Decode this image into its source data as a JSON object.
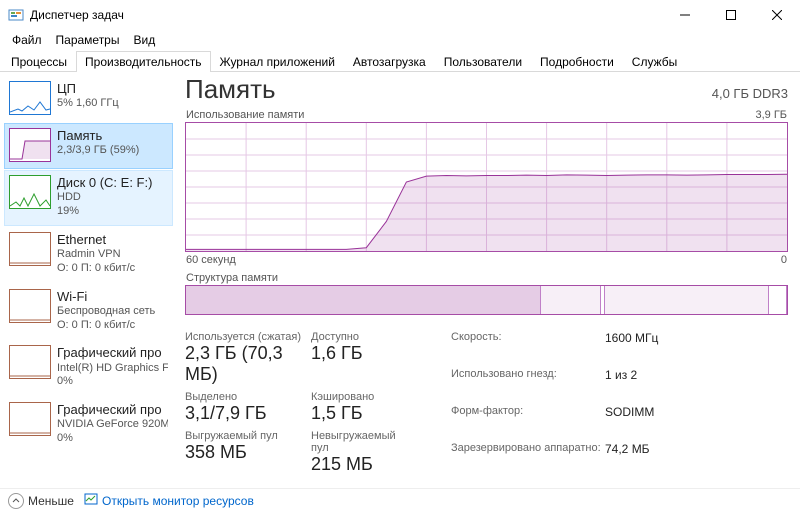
{
  "window": {
    "title": "Диспетчер задач"
  },
  "menu": {
    "file": "Файл",
    "options": "Параметры",
    "view": "Вид"
  },
  "tabs": {
    "processes": "Процессы",
    "performance": "Производительность",
    "app_history": "Журнал приложений",
    "startup": "Автозагрузка",
    "users": "Пользователи",
    "details": "Подробности",
    "services": "Службы"
  },
  "sidebar": [
    {
      "title": "ЦП",
      "sub1": "5%  1,60 ГГц",
      "sub2": null,
      "color": "#1f77d4",
      "sel": false,
      "near": false
    },
    {
      "title": "Память",
      "sub1": "2,3/3,9 ГБ (59%)",
      "sub2": null,
      "color": "#993399",
      "sel": true,
      "near": false
    },
    {
      "title": "Диск 0 (C: E: F:)",
      "sub1": "HDD",
      "sub2": "19%",
      "color": "#2e9e2e",
      "sel": false,
      "near": true
    },
    {
      "title": "Ethernet",
      "sub1": "Radmin VPN",
      "sub2": "О: 0 П: 0 кбит/с",
      "color": "#a9654a",
      "sel": false,
      "near": false
    },
    {
      "title": "Wi-Fi",
      "sub1": "Беспроводная сеть",
      "sub2": "О: 0 П: 0 кбит/с",
      "color": "#a9654a",
      "sel": false,
      "near": false
    },
    {
      "title": "Графический про",
      "sub1": "Intel(R) HD Graphics Family",
      "sub2": "0%",
      "color": "#a9654a",
      "sel": false,
      "near": false
    },
    {
      "title": "Графический про",
      "sub1": "NVIDIA GeForce 920M",
      "sub2": "0%",
      "color": "#a9654a",
      "sel": false,
      "near": false
    }
  ],
  "header": {
    "title": "Память",
    "right": "4,0 ГБ DDR3"
  },
  "chart": {
    "top_left": "Использование памяти",
    "top_right": "3,9 ГБ",
    "bottom_left": "60 секунд",
    "bottom_right": "0"
  },
  "struct_label": "Структура памяти",
  "struct_map": {
    "segments": [
      {
        "kind": "full",
        "pct": 59.0
      },
      {
        "kind": "light",
        "pct": 10.0
      },
      {
        "kind": "empty",
        "pct": 0.8
      },
      {
        "kind": "light",
        "pct": 27.2
      },
      {
        "kind": "empty",
        "pct": 3.0
      }
    ]
  },
  "stats_left": {
    "used_label": "Используется (сжатая)",
    "used_val": "2,3 ГБ (70,3 МБ)",
    "avail_label": "Доступно",
    "avail_val": "1,6 ГБ",
    "commit_label": "Выделено",
    "commit_val": "3,1/7,9 ГБ",
    "cached_label": "Кэшировано",
    "cached_val": "1,5 ГБ",
    "paged_label": "Выгружаемый пул",
    "paged_val": "358 МБ",
    "nonpaged_label": "Невыгружаемый пул",
    "nonpaged_val": "215 МБ"
  },
  "stats_right": {
    "speed_label": "Скорость:",
    "speed_val": "1600 МГц",
    "slots_label": "Использовано гнезд:",
    "slots_val": "1 из 2",
    "form_label": "Форм-фактор:",
    "form_val": "SODIMM",
    "hw_label": "Зарезервировано аппаратно:",
    "hw_val": "74,2 МБ"
  },
  "footer": {
    "fewer": "Меньше",
    "resmon": "Открыть монитор ресурсов"
  },
  "chart_data": {
    "type": "area",
    "title": "Использование памяти",
    "xlabel": "секунд назад",
    "ylabel": "ГБ",
    "ylim": [
      0,
      3.9
    ],
    "x_range_seconds": 60,
    "series": [
      {
        "name": "Memory in use (GB)",
        "x_seconds_ago": [
          60,
          58,
          56,
          54,
          52,
          50,
          48,
          46,
          44,
          42,
          40,
          38,
          36,
          34,
          32,
          30,
          28,
          26,
          24,
          22,
          20,
          18,
          16,
          14,
          12,
          10,
          8,
          6,
          4,
          2,
          0
        ],
        "values": [
          0.05,
          0.05,
          0.05,
          0.05,
          0.05,
          0.05,
          0.05,
          0.05,
          0.05,
          0.1,
          0.9,
          2.1,
          2.28,
          2.3,
          2.29,
          2.3,
          2.3,
          2.31,
          2.3,
          2.32,
          2.31,
          2.3,
          2.31,
          2.32,
          2.32,
          2.31,
          2.32,
          2.33,
          2.33,
          2.33,
          2.34
        ]
      }
    ]
  },
  "colors": {
    "mem": "#993399",
    "mem_fill": "rgba(153,51,153,0.15)",
    "grid": "#e5c8e5"
  }
}
